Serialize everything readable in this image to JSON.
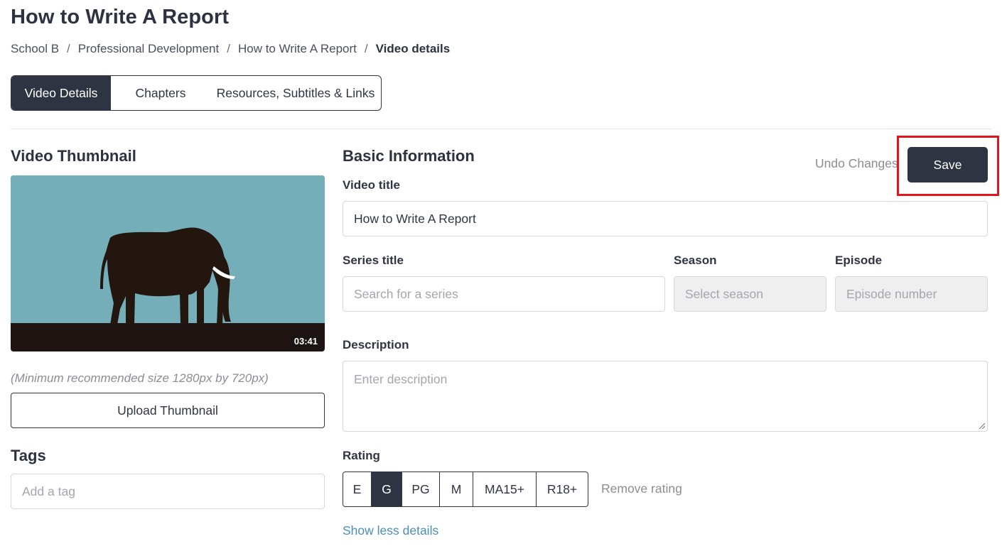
{
  "page": {
    "title": "How to Write A Report"
  },
  "breadcrumb": {
    "items": [
      "School B",
      "Professional Development",
      "How to Write A Report"
    ],
    "separator": "/",
    "current": "Video details"
  },
  "tabs": [
    {
      "label": "Video Details",
      "active": true
    },
    {
      "label": "Chapters",
      "active": false
    },
    {
      "label": "Resources, Subtitles & Links",
      "active": false
    }
  ],
  "thumbnail": {
    "section_title": "Video Thumbnail",
    "duration": "03:41",
    "hint": "(Minimum recommended size 1280px by 720px)",
    "upload_label": "Upload Thumbnail",
    "colors": {
      "sky": "#74aeb8",
      "ground": "#1f1412",
      "elephant": "#23160f",
      "tusk": "#ffffff"
    }
  },
  "tags": {
    "section_title": "Tags",
    "placeholder": "Add a tag"
  },
  "basic_info": {
    "section_title": "Basic Information",
    "undo_label": "Undo Changes",
    "save_label": "Save",
    "video_title": {
      "label": "Video title",
      "value": "How to Write A Report"
    },
    "series_title": {
      "label": "Series title",
      "placeholder": "Search for a series"
    },
    "season": {
      "label": "Season",
      "placeholder": "Select season"
    },
    "episode": {
      "label": "Episode",
      "placeholder": "Episode number"
    },
    "description": {
      "label": "Description",
      "placeholder": "Enter description"
    },
    "rating": {
      "label": "Rating",
      "options": [
        "E",
        "G",
        "PG",
        "M",
        "MA15+",
        "R18+"
      ],
      "selected": "G",
      "remove_label": "Remove rating"
    },
    "show_less_label": "Show less details"
  },
  "colors": {
    "primary_dark": "#2f3443",
    "highlight_red": "#e2141c",
    "link_blue": "#4a8fb8",
    "muted_text": "#8a8d94"
  }
}
